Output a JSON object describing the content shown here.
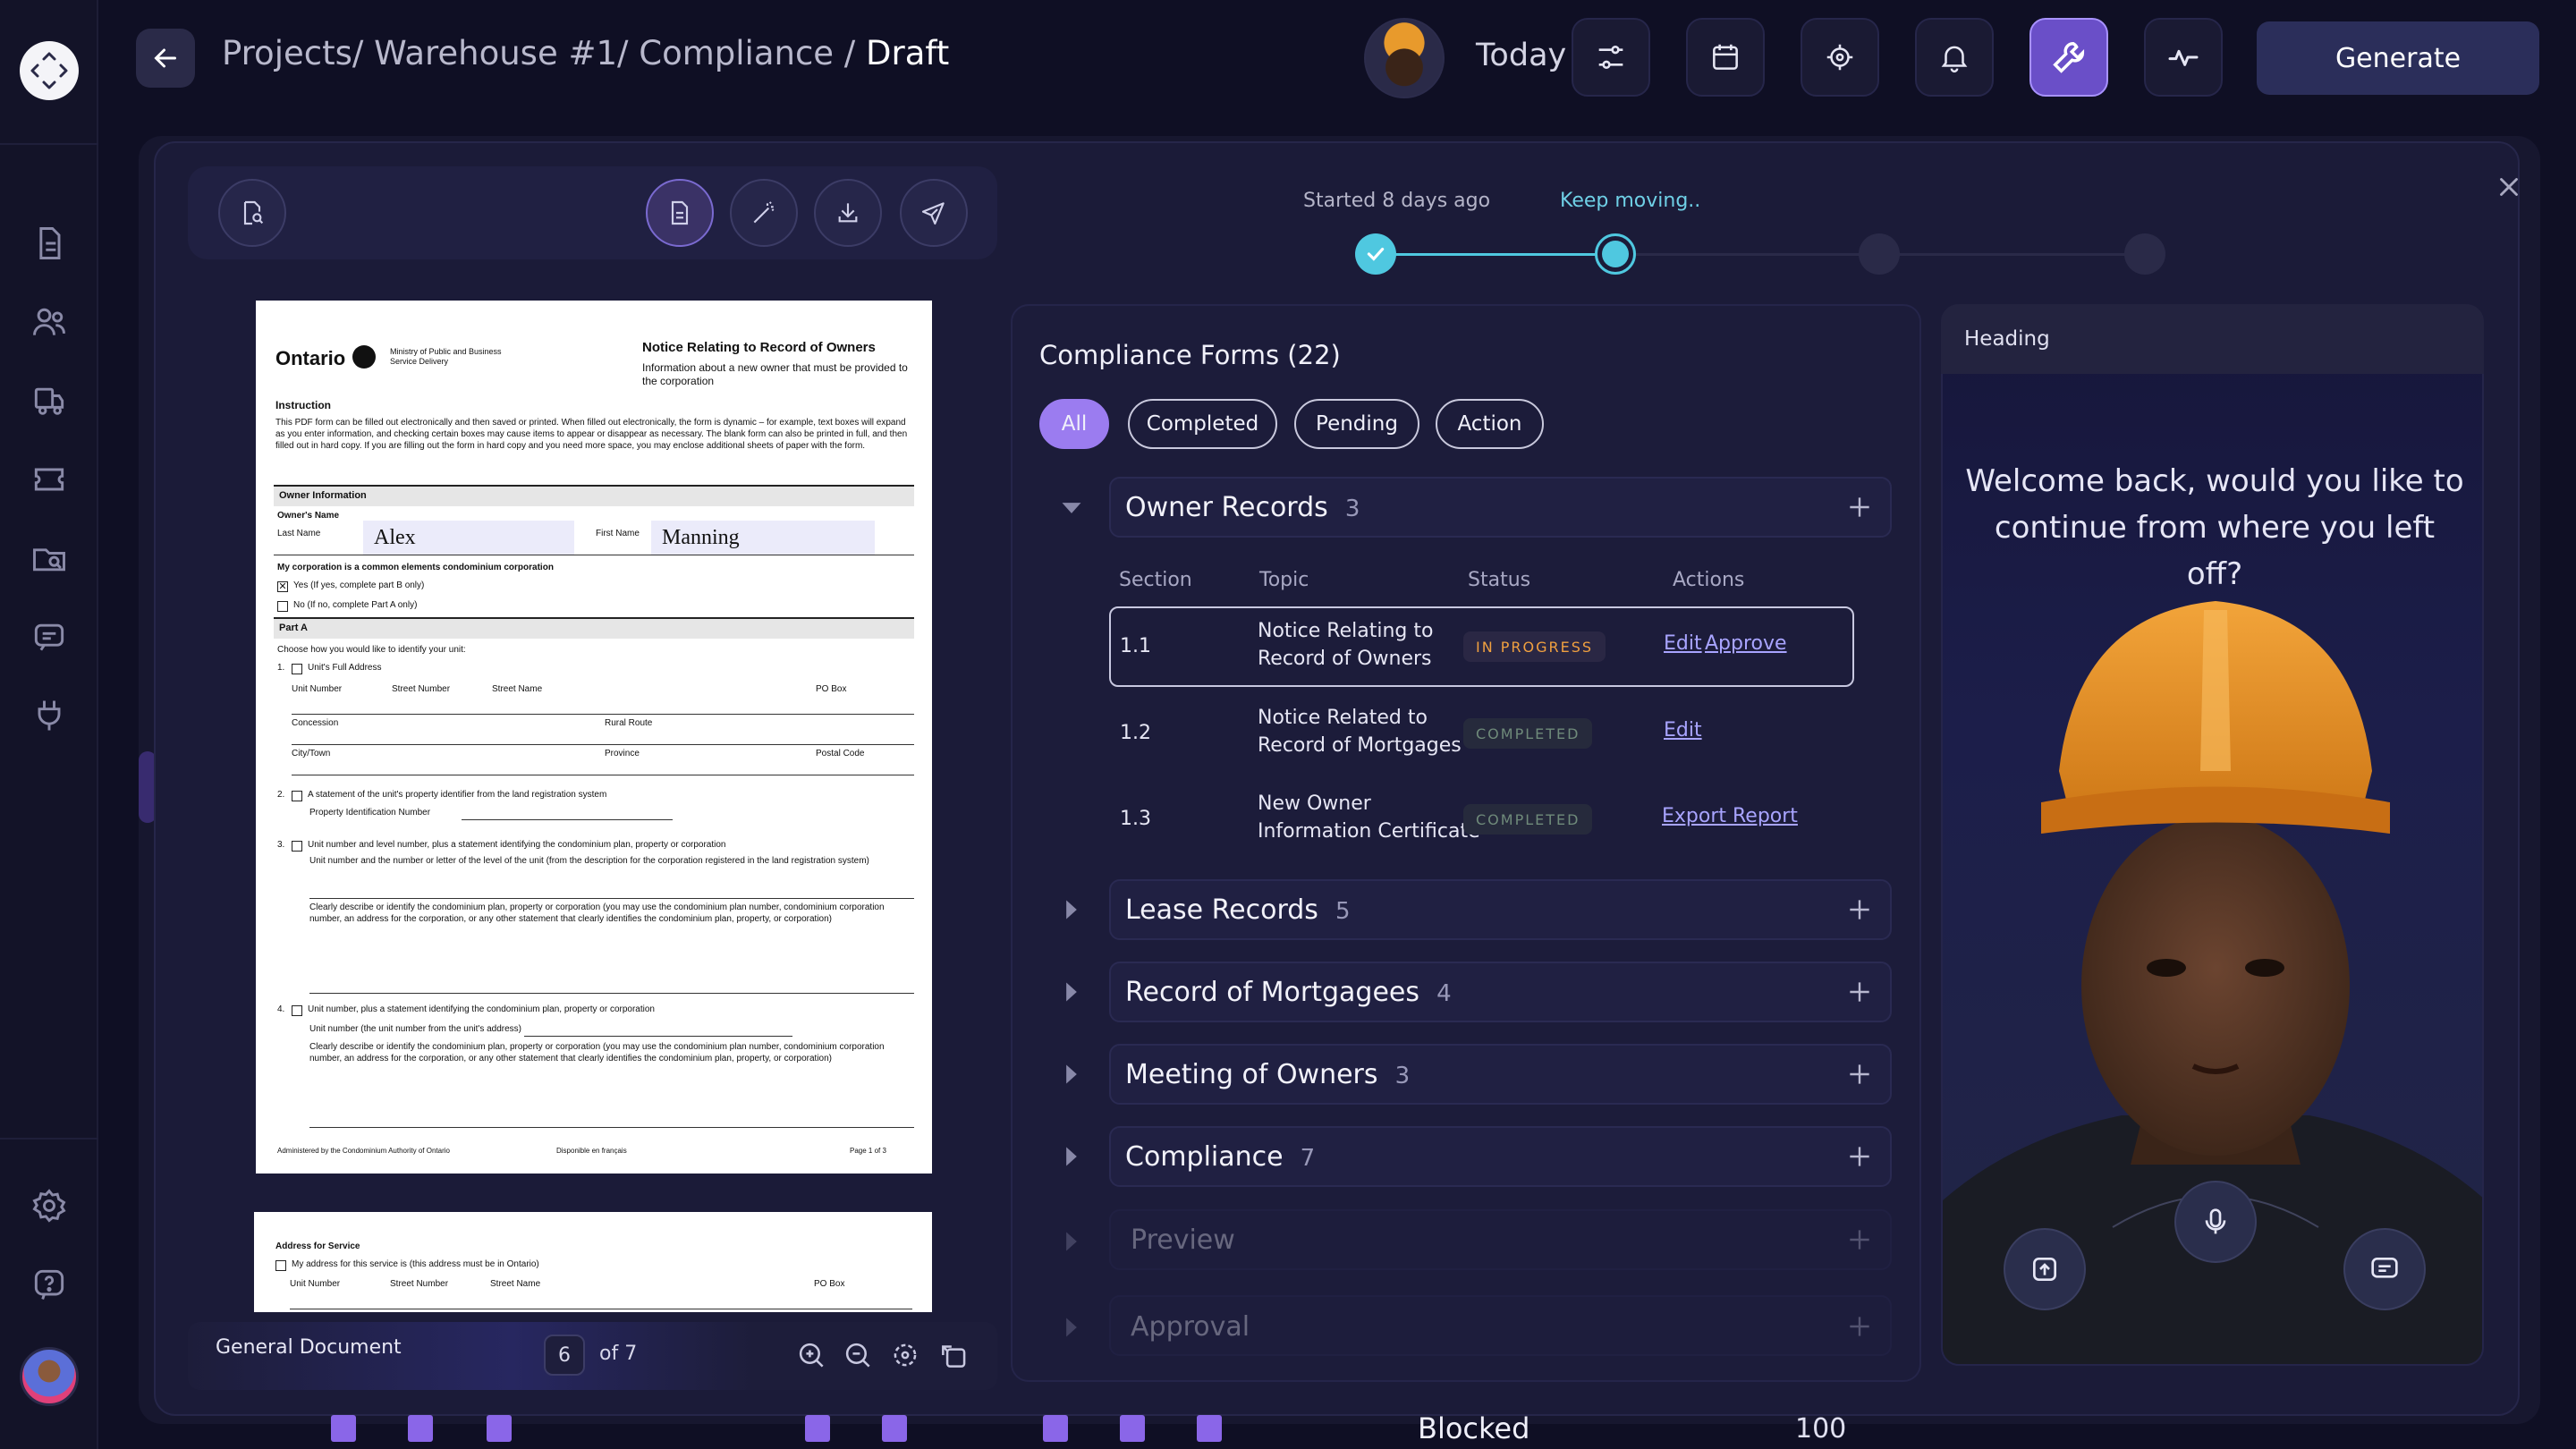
{
  "breadcrumb": {
    "path": "Projects/ Warehouse #1/ Compliance / ",
    "current": "Draft"
  },
  "topbar": {
    "today_label": "Today",
    "generate_label": "Generate"
  },
  "progress": {
    "started_label": "Started 8 days ago",
    "status_label": "Keep moving..",
    "current_step": 2,
    "total_steps": 4,
    "colors": {
      "done": "#4fc8e0",
      "pending": "#2a2a48"
    }
  },
  "document": {
    "name": "General Document",
    "page_current": "6",
    "page_total_label": "of 7",
    "form": {
      "brand": "Ontario",
      "ministry": "Ministry of Public and Business Service Delivery",
      "title": "Notice Relating to Record of Owners",
      "subtitle": "Information about a new owner that must be provided to the corporation",
      "instruction_heading": "Instruction",
      "instruction_text": "This PDF form can be filled out electronically and then saved or printed. When filled out electronically, the form is dynamic – for example, text boxes will expand as you enter information, and checking certain boxes may cause items to appear or disappear as necessary. The blank form can also be printed in full, and then filled out in hard copy. If you are filling out the form in hard copy and you need more space, you may enclose additional sheets of paper with the form.",
      "owner_info": "Owner Information",
      "owner_name": "Owner's Name",
      "last_name_label": "Last Name",
      "last_name": "Alex",
      "first_name_label": "First Name",
      "first_name": "Manning",
      "condo_q": "My corporation is a common elements condominium corporation",
      "opt_yes": "Yes (If yes, complete part B only)",
      "opt_no": "No (If no, complete Part A only)",
      "part_a": "Part A",
      "choose": "Choose how you would like to identify your unit:",
      "q1": "Unit's Full Address",
      "unit_number": "Unit Number",
      "street_number": "Street Number",
      "street_name": "Street Name",
      "po_box": "PO Box",
      "concession": "Concession",
      "rural_route": "Rural Route",
      "city": "City/Town",
      "province": "Province",
      "postal": "Postal Code",
      "q2": "A statement of the unit's property identifier from the land registration system",
      "pin": "Property Identification Number",
      "q3": "Unit number and level number, plus a statement identifying the condominium plan, property or corporation",
      "q3_sub": "Unit number and the number or letter of the level of the unit (from the description for the corporation registered in the land registration system)",
      "describe": "Clearly describe or identify the condominium plan, property or corporation (you may use the condominium plan number, condominium corporation number, an address for the corporation, or any other statement that clearly identifies the condominium plan, property, or corporation)",
      "q4": "Unit number, plus a statement identifying the condominium plan, property or corporation",
      "q4_sub": "Unit number (the unit number from the unit's address)",
      "footer_left": "Administered by the Condominium Authority of Ontario",
      "footer_mid": "Disponible en français",
      "footer_right": "Page 1 of 3",
      "p2_heading": "Address for Service",
      "p2_opt": "My address for this service is (this address must be in Ontario)",
      "p2_unit": "Unit Number",
      "p2_street_no": "Street Number",
      "p2_street": "Street Name",
      "p2_po": "PO Box"
    }
  },
  "compliance": {
    "title": "Compliance Forms (22)",
    "filters": [
      "All",
      "Completed",
      "Pending",
      "Action"
    ],
    "active_filter": "All",
    "groups": [
      {
        "label": "Owner Records",
        "count": "3",
        "expanded": true
      },
      {
        "label": "Lease Records",
        "count": "5"
      },
      {
        "label": "Record of Mortgagees",
        "count": "4"
      },
      {
        "label": "Meeting of Owners",
        "count": "3"
      },
      {
        "label": "Compliance",
        "count": "7"
      },
      {
        "label": "Preview",
        "count": ""
      },
      {
        "label": "Approval",
        "count": ""
      }
    ],
    "table": {
      "headers": [
        "Section",
        "Topic",
        "Status",
        "Actions"
      ],
      "rows": [
        {
          "section": "1.1",
          "topic_a": "Notice Relating to",
          "topic_b": "Record of Owners",
          "status": "IN PROGRESS",
          "action_a": "Edit",
          "action_b": "Approve"
        },
        {
          "section": "1.2",
          "topic_a": "Notice Related to",
          "topic_b": "Record of Mortgages",
          "status": "COMPLETED",
          "action_a": "Edit",
          "action_b": ""
        },
        {
          "section": "1.3",
          "topic_a": "New Owner",
          "topic_b": "Information Certificate",
          "status": "COMPLETED",
          "action_a": "Export Report",
          "action_b": ""
        }
      ]
    }
  },
  "assistant": {
    "heading": "Heading",
    "message": "Welcome back, would you like to continue from where you left off?"
  },
  "background": {
    "blocked_label": "Blocked",
    "blocked_value": "100"
  }
}
